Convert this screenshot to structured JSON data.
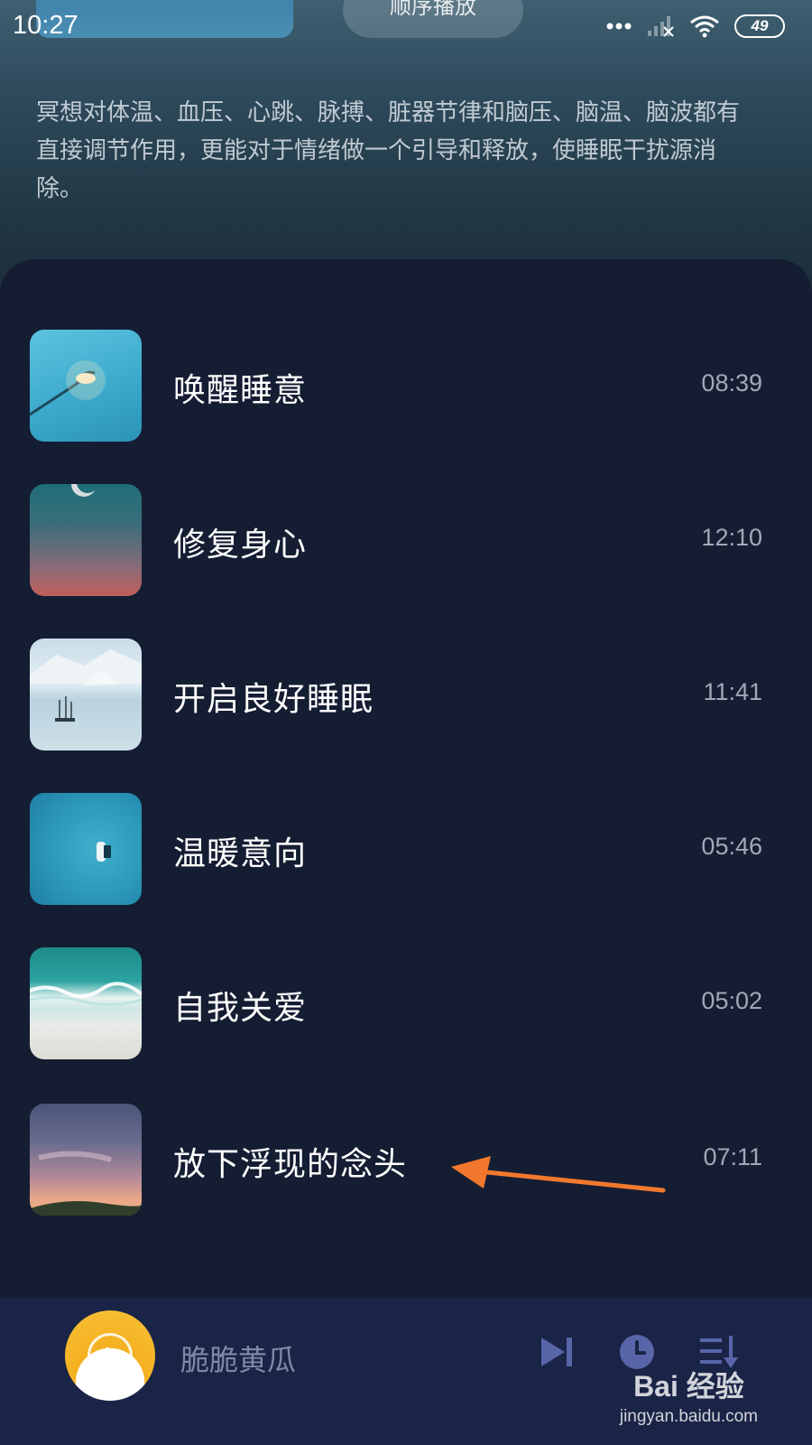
{
  "status_bar": {
    "time": "10:27",
    "battery": "49"
  },
  "header": {
    "play_mode": "顺序播放",
    "description": "冥想对体温、血压、心跳、脉搏、脏器节律和脑压、脑温、脑波都有直接调节作用，更能对于情绪做一个引导和释放，使睡眠干扰源消除。"
  },
  "tracks": [
    {
      "title": "唤醒睡意",
      "duration": "08:39",
      "thumb": "street-lamp"
    },
    {
      "title": "修复身心",
      "duration": "12:10",
      "thumb": "moon-gradient"
    },
    {
      "title": "开启良好睡眠",
      "duration": "11:41",
      "thumb": "sailboat-ice"
    },
    {
      "title": "温暖意向",
      "duration": "05:46",
      "thumb": "boat-ocean"
    },
    {
      "title": "自我关爱",
      "duration": "05:02",
      "thumb": "beach-waves"
    },
    {
      "title": "放下浮现的念头",
      "duration": "07:11",
      "thumb": "dusk-sky"
    }
  ],
  "player": {
    "now_playing": "脆脆黄瓜",
    "controls": [
      "skip-next-icon",
      "timer-icon",
      "playlist-icon"
    ]
  },
  "watermark": {
    "logo": "Bai 经验",
    "url": "jingyan.baidu.com"
  },
  "colors": {
    "background": "#151d33",
    "player_bar": "#1a2446",
    "control_icon": "#5865a8",
    "annotation_arrow": "#f2782d"
  }
}
